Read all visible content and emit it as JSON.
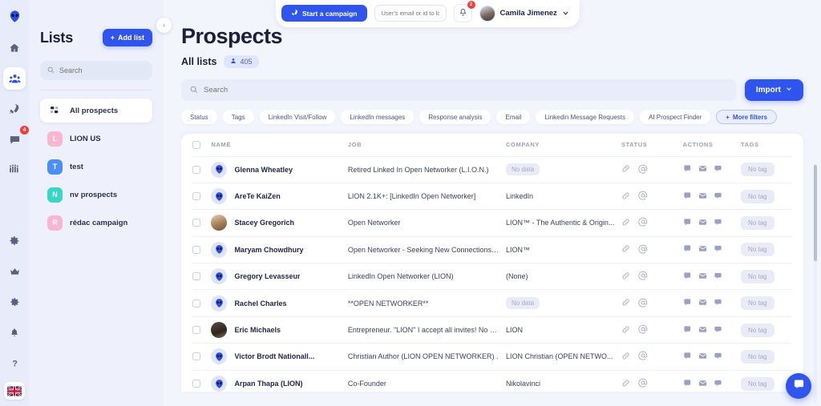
{
  "colors": {
    "accent": "#3055ed",
    "badge_red": "#f53b3b",
    "bg": "#f3f5fd",
    "panel": "#eef1fb",
    "muted": "#9aa0bd"
  },
  "rail": {
    "logo_icon": "alien-logo-icon",
    "items": [
      {
        "name": "home-icon",
        "label": "Home",
        "active": false,
        "badge": ""
      },
      {
        "name": "prospects-icon",
        "label": "Prospects",
        "active": true,
        "badge": ""
      },
      {
        "name": "campaigns-rocket-icon",
        "label": "Campaigns",
        "active": false,
        "badge": ""
      },
      {
        "name": "messages-icon",
        "label": "Messages",
        "active": false,
        "badge": "4"
      },
      {
        "name": "team-icon",
        "label": "Team",
        "active": false,
        "badge": ""
      }
    ],
    "bottom_items": [
      {
        "name": "settings-gear-icon",
        "label": "Settings"
      },
      {
        "name": "crown-icon",
        "label": "Upgrade"
      },
      {
        "name": "preferences-gear-icon",
        "label": "Preferences"
      },
      {
        "name": "bell-icon",
        "label": "Notifications"
      },
      {
        "name": "help-question-icon",
        "label": "Help"
      }
    ],
    "language_flag": "uk-flag-icon"
  },
  "lists_panel": {
    "title": "Lists",
    "add_button": "Add list",
    "search_placeholder": "Search",
    "search_value": "",
    "all_prospects_label": "All prospects",
    "items": [
      {
        "initial": "L",
        "label": "LION US",
        "color": "#f9b6d0"
      },
      {
        "initial": "T",
        "label": "test",
        "color": "#4d8df6"
      },
      {
        "initial": "N",
        "label": "nv prospects",
        "color": "#38d6c4"
      },
      {
        "initial": "R",
        "label": "rédac campaign",
        "color": "#f9b6d0"
      }
    ],
    "collapse_icon": "chevron-left-icon"
  },
  "topbar": {
    "campaign_button": "Start a campaign",
    "login_placeholder": "User's email or id to login",
    "login_value": "",
    "notification_count": "2",
    "user_name": "Camila Jimenez",
    "chevron_icon": "chevron-down-icon"
  },
  "header": {
    "title": "Prospects",
    "all_lists_label": "All lists",
    "count": "405",
    "search_placeholder": "Search",
    "search_value": "",
    "import_button": "Import"
  },
  "filters": [
    {
      "label": "Status",
      "primary": false
    },
    {
      "label": "Tags",
      "primary": false
    },
    {
      "label": "LinkedIn Visit/Follow",
      "primary": false
    },
    {
      "label": "LinkedIn messages",
      "primary": false
    },
    {
      "label": "Response analysis",
      "primary": false
    },
    {
      "label": "Email",
      "primary": false
    },
    {
      "label": "Linkedin Message Requests",
      "primary": false
    },
    {
      "label": "AI Prospect Finder",
      "primary": false
    },
    {
      "label": "More filters",
      "primary": true
    }
  ],
  "table": {
    "columns": [
      "NAME",
      "JOB",
      "COMPANY",
      "STATUS",
      "ACTIONS",
      "TAGS"
    ],
    "tag_placeholder": "No tag",
    "no_data_label": "No data",
    "status_icons": [
      "link-icon",
      "at-sign-icon"
    ],
    "action_icons": [
      "linkedin-message-icon",
      "email-icon",
      "comment-icon"
    ],
    "rows": [
      {
        "name": "Glenna Wheatley",
        "avatar": "alien",
        "job": "Retired Linked In Open Networker (L.I.O.N.)",
        "company": "",
        "company_nodata": true,
        "tag": "No tag"
      },
      {
        "name": "AreTe KaiZen",
        "avatar": "alien",
        "job": "LION 2.1K+: [LinkedIn Open Networker]",
        "company": "LinkedIn",
        "company_nodata": false,
        "tag": "No tag"
      },
      {
        "name": "Stacey Gregorich",
        "avatar": "photo1",
        "job": "Open Networker",
        "company": "LION™ - The Authentic & Origin...",
        "company_nodata": false,
        "tag": "No tag"
      },
      {
        "name": "Maryam Chowdhury",
        "avatar": "alien",
        "job": "Open Networker - Seeking New Connections & ...",
        "company": "LION™",
        "company_nodata": false,
        "tag": "No tag"
      },
      {
        "name": "Gregory Levasseur",
        "avatar": "alien",
        "job": "LinkedIn Open Networker (LION)",
        "company": "(None)",
        "company_nodata": false,
        "tag": "No tag"
      },
      {
        "name": "Rachel Charles",
        "avatar": "alien",
        "job": "**OPEN NETWORKER**",
        "company": "",
        "company_nodata": true,
        "tag": "No tag"
      },
      {
        "name": "Eric Michaels",
        "avatar": "photo2",
        "job": "Entrepreneur. \"LION\" I accept all invites! No Spa...",
        "company": "LION",
        "company_nodata": false,
        "tag": "No tag"
      },
      {
        "name": "Victor Brodt Nationall...",
        "avatar": "alien",
        "job": "Christian Author (LION OPEN NETWORKER) .",
        "company": "LION Christian (OPEN NETWO...",
        "company_nodata": false,
        "tag": "No tag"
      },
      {
        "name": "Arpan Thapa (LION)",
        "avatar": "alien",
        "job": "Co-Founder",
        "company": "Nikolavinci",
        "company_nodata": false,
        "tag": "No tag"
      }
    ]
  },
  "chat_fab": {
    "icon": "chat-bubble-icon"
  }
}
